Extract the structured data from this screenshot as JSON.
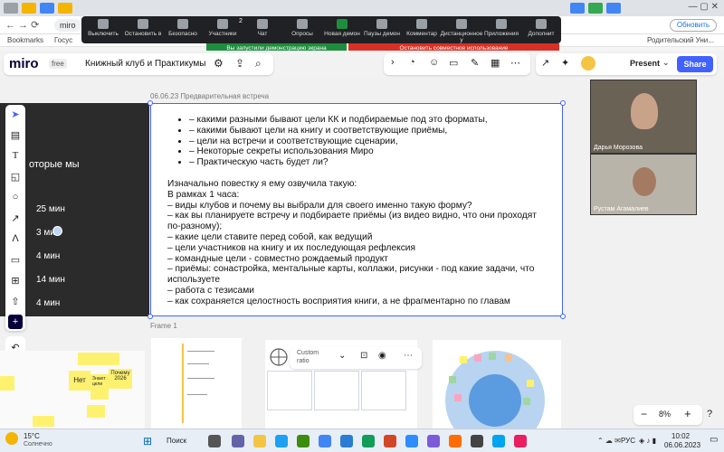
{
  "browser": {
    "address_text": "miro",
    "bookmarks": [
      "Bookmarks",
      "Госус"
    ],
    "bookmark_right": "Родительский Уни...",
    "update_button": "Обновить"
  },
  "zoom_toolbar": {
    "items": [
      "Выключить",
      "Остановить в",
      "Безопасно",
      "Участники",
      "Чат",
      "Опросы",
      "Новая демон",
      "Паузы демон",
      "Комментар",
      "Дистанционное у",
      "Приложения",
      "Дополнит"
    ],
    "participants_count": "2",
    "share_status": "Вы запустили демонстрацию экрана",
    "stop_share": "Остановить совместное использование"
  },
  "miro": {
    "logo": "miro",
    "plan_badge": "free",
    "board_title": "Книжный клуб и Практикумы",
    "present_label": "Present",
    "share_label": "Share"
  },
  "canvas": {
    "frame_label_top": "06.06.23 Предварительная встреча",
    "frame_label_bottom": "Frame 1",
    "dark_frame_text": "оторые мы",
    "times": [
      "25 мин",
      "3 ми",
      "4 мин",
      "14 мин",
      "4 мин"
    ],
    "bullets": [
      "– какими разными бывают цели КК и подбираемые под это форматы,",
      "– какими бывают цели на книгу и соответствующие приёмы,",
      "– цели на встречи и соответствующие сценарии,",
      "– Некоторые секреты использования Миро",
      "– Практическую часть будет ли?"
    ],
    "paragraph_lines": [
      "Изначально повестку я ему озвучила такую:",
      "В рамках 1 часа:",
      "– виды клубов и почему вы выбрали для своего именно такую форму?",
      "– как вы планируете встречу и подбираете приёмы (из видео видно, что они проходят по-разному);",
      "– какие цели ставите перед собой, как ведущий",
      "– цели участников на книгу и их последующая рефлексия",
      "– командные цели - совместно рождаемый продукт",
      "– приёмы: сонастройка, ментальные карты, коллажи, рисунки - под какие задачи, что используете",
      "– работа с тезисами",
      "– как сохраняется целостность восприятия книги, а не фрагментарно по главам"
    ],
    "sticky_notes": [
      "Нет",
      "Почему 2026",
      "Знают цели"
    ],
    "custom_ratio": "Custom ratio",
    "zoom_level": "8%"
  },
  "participants": [
    {
      "name": "Дарья Морозова"
    },
    {
      "name": "Рустам Агамалиев"
    }
  ],
  "taskbar": {
    "weather_temp": "15°C",
    "weather_desc": "Солнечно",
    "search_label": "Поиск",
    "lang": "РУС",
    "time": "10:02",
    "date": "06.06.2023"
  },
  "colors": {
    "miro_blue": "#4262ff",
    "zoom_green": "#1e8e3e",
    "zoom_red": "#d93025",
    "sticky_yellow": "#fff170"
  }
}
